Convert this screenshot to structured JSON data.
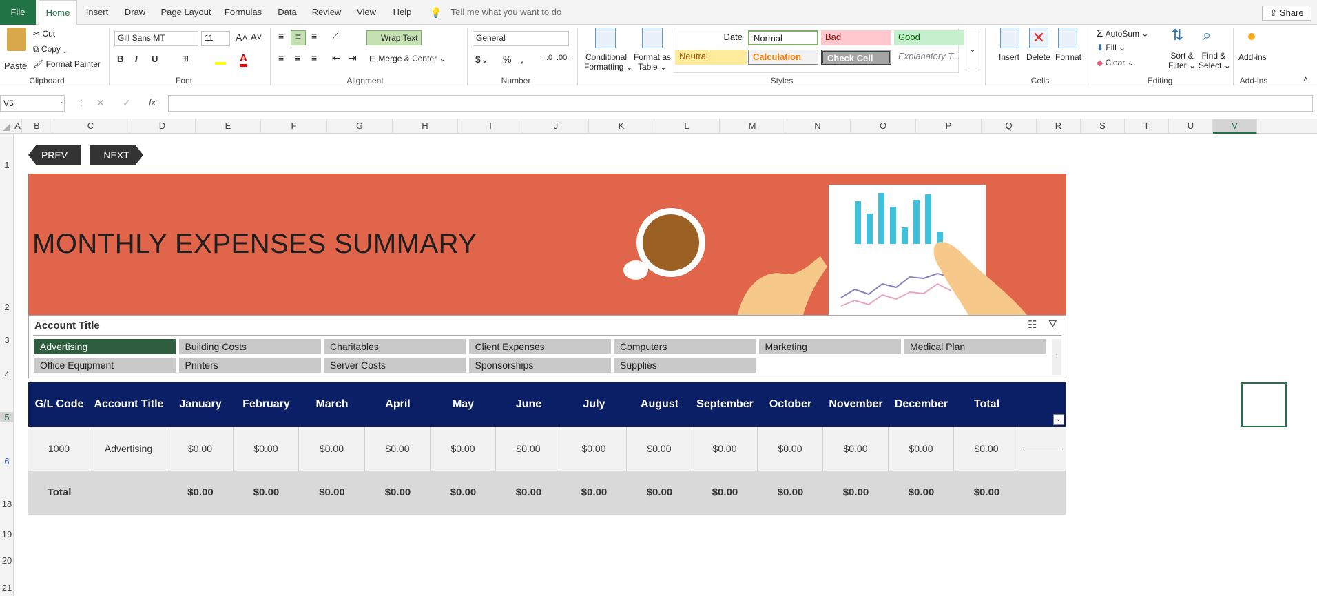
{
  "tabs": [
    "File",
    "Home",
    "Insert",
    "Draw",
    "Page Layout",
    "Formulas",
    "Data",
    "Review",
    "View",
    "Help"
  ],
  "tell_me": "Tell me what you want to do",
  "share": "Share",
  "clipboard": {
    "paste": "Paste",
    "cut": "Cut",
    "copy": "Copy",
    "format_painter": "Format Painter",
    "label": "Clipboard"
  },
  "font": {
    "name": "Gill Sans MT",
    "size": "11",
    "label": "Font",
    "bold": "B",
    "italic": "I",
    "underline": "U"
  },
  "alignment": {
    "wrap_text": "Wrap Text",
    "merge_center": "Merge & Center",
    "label": "Alignment"
  },
  "number": {
    "format": "General",
    "label": "Number",
    "percent": "%",
    "comma": ","
  },
  "styles": {
    "conditional": "Conditional",
    "conditional2": "Formatting",
    "format_as": "Format as",
    "format_as2": "Table",
    "date": "Date",
    "normal": "Normal",
    "bad": "Bad",
    "good": "Good",
    "neutral": "Neutral",
    "calculation": "Calculation",
    "check_cell": "Check Cell",
    "explanatory": "Explanatory T...",
    "label": "Styles"
  },
  "cells": {
    "insert": "Insert",
    "delete": "Delete",
    "format": "Format",
    "label": "Cells"
  },
  "editing": {
    "autosum": "AutoSum",
    "fill": "Fill",
    "clear": "Clear",
    "sort": "Sort &",
    "sort2": "Filter",
    "find": "Find &",
    "find2": "Select",
    "label": "Editing"
  },
  "addins": {
    "label": "Add-ins",
    "btn": "Add-ins"
  },
  "formula_bar": {
    "name_box": "V5",
    "fx": "fx",
    "value": ""
  },
  "columns": [
    "A",
    "B",
    "C",
    "D",
    "E",
    "F",
    "G",
    "H",
    "I",
    "J",
    "K",
    "L",
    "M",
    "N",
    "O",
    "P",
    "Q",
    "R",
    "S",
    "T",
    "U",
    "V"
  ],
  "rows": [
    "1",
    "2",
    "3",
    "4",
    "5",
    "6",
    "18",
    "19",
    "20",
    "21"
  ],
  "nav": {
    "prev": "PREV",
    "next": "NEXT"
  },
  "banner_title": "MONTHLY EXPENSES SUMMARY",
  "slicer": {
    "title": "Account Title",
    "items": [
      "Advertising",
      "Building Costs",
      "Charitables",
      "Client Expenses",
      "Computers",
      "Marketing",
      "Medical Plan",
      "Office Equipment",
      "Printers",
      "Server Costs",
      "Sponsorships",
      "Supplies"
    ]
  },
  "table": {
    "headers": [
      "G/L Code",
      "Account Title",
      "January",
      "February",
      "March",
      "April",
      "May",
      "June",
      "July",
      "August",
      "September",
      "October",
      "November",
      "December",
      "Total"
    ],
    "row": [
      "1000",
      "Advertising",
      "$0.00",
      "$0.00",
      "$0.00",
      "$0.00",
      "$0.00",
      "$0.00",
      "$0.00",
      "$0.00",
      "$0.00",
      "$0.00",
      "$0.00",
      "$0.00",
      "$0.00"
    ],
    "total": [
      "Total",
      "",
      "$0.00",
      "$0.00",
      "$0.00",
      "$0.00",
      "$0.00",
      "$0.00",
      "$0.00",
      "$0.00",
      "$0.00",
      "$0.00",
      "$0.00",
      "$0.00",
      "$0.00"
    ]
  },
  "colors": {
    "excel_green": "#217346",
    "banner": "#e0654a",
    "header_navy": "#0a1f66",
    "slicer_selected": "#2e5e3e"
  }
}
